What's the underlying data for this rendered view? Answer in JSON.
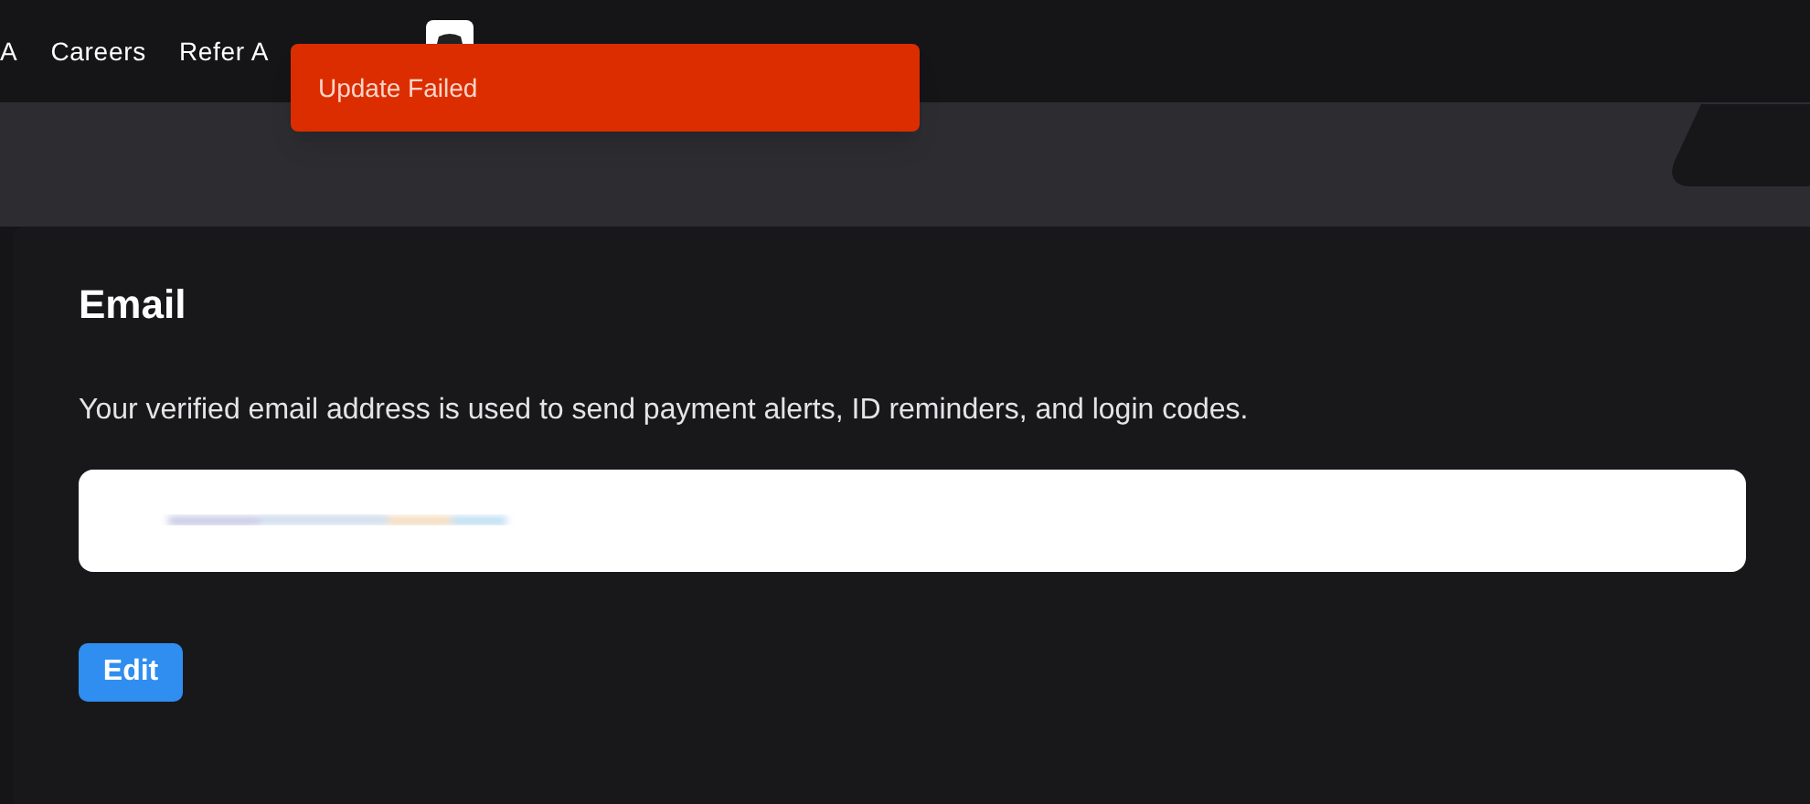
{
  "nav": {
    "items": [
      "A",
      "Careers",
      "Refer A"
    ]
  },
  "toast": {
    "message": "Update Failed"
  },
  "email": {
    "title": "Email",
    "description": "Your verified email address is used to send payment alerts, ID reminders, and login codes.",
    "button": "Edit"
  }
}
